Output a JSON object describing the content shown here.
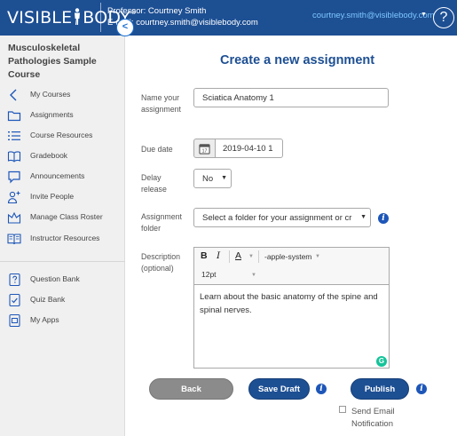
{
  "header": {
    "logo_text_a": "VISIBLE",
    "logo_text_b": "BODY",
    "logo_mark": "®",
    "professor": "Professor: Courtney Smith",
    "email": "E-mail: courtney.smith@visiblebody.com",
    "user_menu": "courtney.smith@visiblebody.com",
    "help": "?"
  },
  "sidebar": {
    "course_title": "Musculoskeletal Pathologies Sample Course",
    "collapse": "<",
    "items": [
      {
        "label": "My Courses",
        "icon": "chevron-left-icon"
      },
      {
        "label": "Assignments",
        "icon": "folder-icon"
      },
      {
        "label": "Course Resources",
        "icon": "list-icon"
      },
      {
        "label": "Gradebook",
        "icon": "book-icon"
      },
      {
        "label": "Announcements",
        "icon": "speech-bubble-icon"
      },
      {
        "label": "Invite People",
        "icon": "add-person-icon"
      },
      {
        "label": "Manage Class Roster",
        "icon": "roster-icon"
      },
      {
        "label": "Instructor Resources",
        "icon": "open-book-icon"
      },
      {
        "label": "Question Bank",
        "icon": "question-doc-icon"
      },
      {
        "label": "Quiz Bank",
        "icon": "quiz-check-icon"
      },
      {
        "label": "My Apps",
        "icon": "app-icon"
      }
    ]
  },
  "main": {
    "title": "Create a new assignment",
    "name_label": "Name your assignment",
    "name_value": "Sciatica Anatomy 1",
    "due_label": "Due date",
    "due_value": "2019-04-10 1",
    "calendar_day": "17",
    "delay_label": "Delay release",
    "delay_value": "No",
    "folder_label": "Assignment folder",
    "folder_value": "Select a folder for your assignment or cr",
    "desc_label": "Description (optional)",
    "toolbar": {
      "bold": "B",
      "italic": "I",
      "color": "A",
      "font_family": "-apple-system",
      "font_size": "12pt"
    },
    "description": "Learn about the basic anatomy of the spine and spinal nerves.",
    "grammarly": "G",
    "back": "Back",
    "save_draft": "Save Draft",
    "publish": "Publish",
    "send_email": "Send Email Notification",
    "info": "i"
  },
  "colors": {
    "header_bg": "#1d4f93",
    "accent": "#1d56b8",
    "sidebar_bg": "#f0f0f0",
    "grammarly": "#15c39a"
  }
}
